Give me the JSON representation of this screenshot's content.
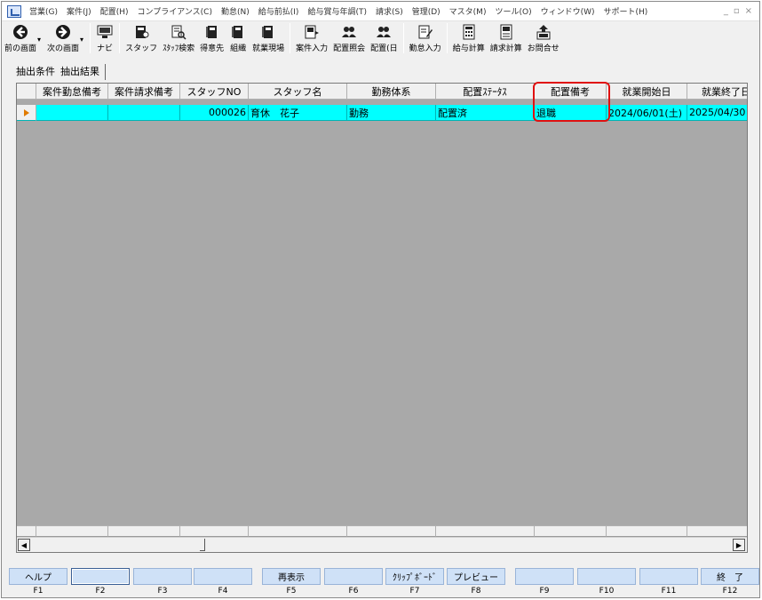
{
  "menubar": {
    "items": [
      "営業(G)",
      "案件(J)",
      "配置(H)",
      "コンプライアンス(C)",
      "勤怠(N)",
      "給与前払(I)",
      "給与賞与年調(T)",
      "請求(S)",
      "管理(D)",
      "マスタ(M)",
      "ツール(O)",
      "ウィンドウ(W)",
      "サポート(H)"
    ],
    "minimize": "_",
    "restore": "▫",
    "close": "×"
  },
  "toolbar": {
    "back_label": "前の画面",
    "forward_label": "次の画面",
    "navi_label": "ナビ",
    "staff_label": "スタッフ",
    "staff_search_label": "ｽﾀｯﾌ検索",
    "client_label": "得意先",
    "org_label": "組織",
    "worksite_label": "就業現場",
    "case_input_label": "案件入力",
    "placement_query_label": "配置照会",
    "placement_day_label": "配置(日",
    "attendance_input_label": "勤怠入力",
    "payroll_calc_label": "給与計算",
    "billing_calc_label": "請求計算",
    "contact_label": "お問合せ",
    "dropdown_glyph": "▾"
  },
  "tabs": {
    "conditions": "抽出条件",
    "results": "抽出結果"
  },
  "grid": {
    "columns": [
      "案件勤怠備考",
      "案件請求備考",
      "スタッフNO",
      "スタッフ名",
      "勤務体系",
      "配置ｽﾃｰﾀｽ",
      "配置備考",
      "就業開始日",
      "就業終了日"
    ],
    "rows": [
      {
        "case_attendance_note": "",
        "case_billing_note": "",
        "staff_no": "000026",
        "staff_name": "育休　花子",
        "work_system": "勤務",
        "placement_status": "配置済",
        "placement_note": "退職",
        "start_date": "2024/06/01(土)",
        "end_date": "2025/04/30"
      }
    ],
    "scroll_left": "◀",
    "scroll_right": "▶"
  },
  "fkeys": [
    {
      "key": "F1",
      "label": "ヘルプ"
    },
    {
      "key": "F2",
      "label": ""
    },
    {
      "key": "F3",
      "label": ""
    },
    {
      "key": "F4",
      "label": ""
    },
    {
      "key": "F5",
      "label": "再表示"
    },
    {
      "key": "F6",
      "label": ""
    },
    {
      "key": "F7",
      "label": "ｸﾘｯﾌﾟﾎﾞｰﾄﾞ"
    },
    {
      "key": "F8",
      "label": "プレビュー"
    },
    {
      "key": "F9",
      "label": ""
    },
    {
      "key": "F10",
      "label": ""
    },
    {
      "key": "F11",
      "label": ""
    },
    {
      "key": "F12",
      "label": "終　了"
    }
  ],
  "colors": {
    "selected_row": "#00ffff",
    "grid_background": "#a9a9a9",
    "highlight": "#e01010",
    "fkey_button": "#cfe1f7"
  }
}
